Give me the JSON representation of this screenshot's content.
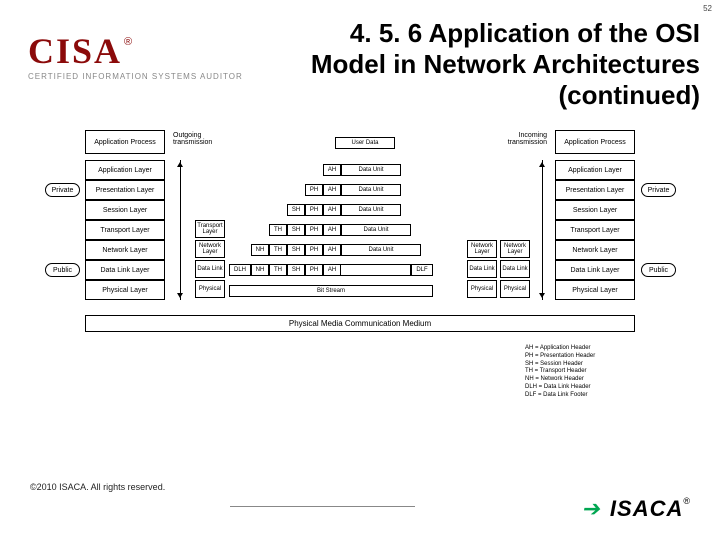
{
  "page_number": "52",
  "logo": {
    "text": "CISA",
    "reg": "®",
    "subtitle": "CERTIFIED INFORMATION SYSTEMS AUDITOR"
  },
  "title_line1": "4. 5. 6 Application of the OSI",
  "title_line2": "Model in Network Architectures",
  "title_line3": "(continued)",
  "diagram": {
    "left_stack": [
      "Application Process",
      "Application Layer",
      "Presentation Layer",
      "Session Layer",
      "Transport Layer",
      "Network Layer",
      "Data Link Layer",
      "Physical Layer"
    ],
    "right_stack": [
      "Application Process",
      "Application Layer",
      "Presentation Layer",
      "Session Layer",
      "Transport Layer",
      "Network Layer",
      "Data Link Layer",
      "Physical Layer"
    ],
    "outgoing": "Outgoing transmission",
    "incoming": "Incoming transmission",
    "private": "Private",
    "public": "Public",
    "private_r": "Private",
    "public_r": "Public",
    "rows": [
      {
        "hdr": [],
        "du": "User Data"
      },
      {
        "hdr": [
          "AH"
        ],
        "du": "Data Unit"
      },
      {
        "hdr": [
          "PH",
          "AH"
        ],
        "du": "Data Unit"
      },
      {
        "hdr": [
          "SH",
          "PH",
          "AH"
        ],
        "du": "Data Unit"
      },
      {
        "hdr": [
          "TH",
          "SH",
          "PH",
          "AH"
        ],
        "du": "Data Unit"
      },
      {
        "hdr": [
          "NH",
          "TH",
          "SH",
          "PH",
          "AH"
        ],
        "du": "Data Unit"
      },
      {
        "hdr": [
          "DLH",
          "NH",
          "TH",
          "SH",
          "PH",
          "AH"
        ],
        "du": "",
        "tail": "DLF"
      }
    ],
    "bit_stream": "Bit Stream",
    "left_mini": [
      "Transport Layer",
      "Network Layer",
      "Data Link",
      "Physical"
    ],
    "right_mini": [
      "Network Layer",
      "Data Link",
      "Physical"
    ],
    "medium": "Physical Media Communication Medium",
    "legend": [
      "AH = Application Header",
      "PH = Presentation Header",
      "SH = Session Header",
      "TH = Transport Header",
      "NH = Network Header",
      "DLH = Data Link Header",
      "DLF = Data Link Footer"
    ]
  },
  "footer": {
    "copyright": "©2010 ISACA.  All rights reserved.",
    "brand": "ISACA",
    "reg": "®"
  }
}
